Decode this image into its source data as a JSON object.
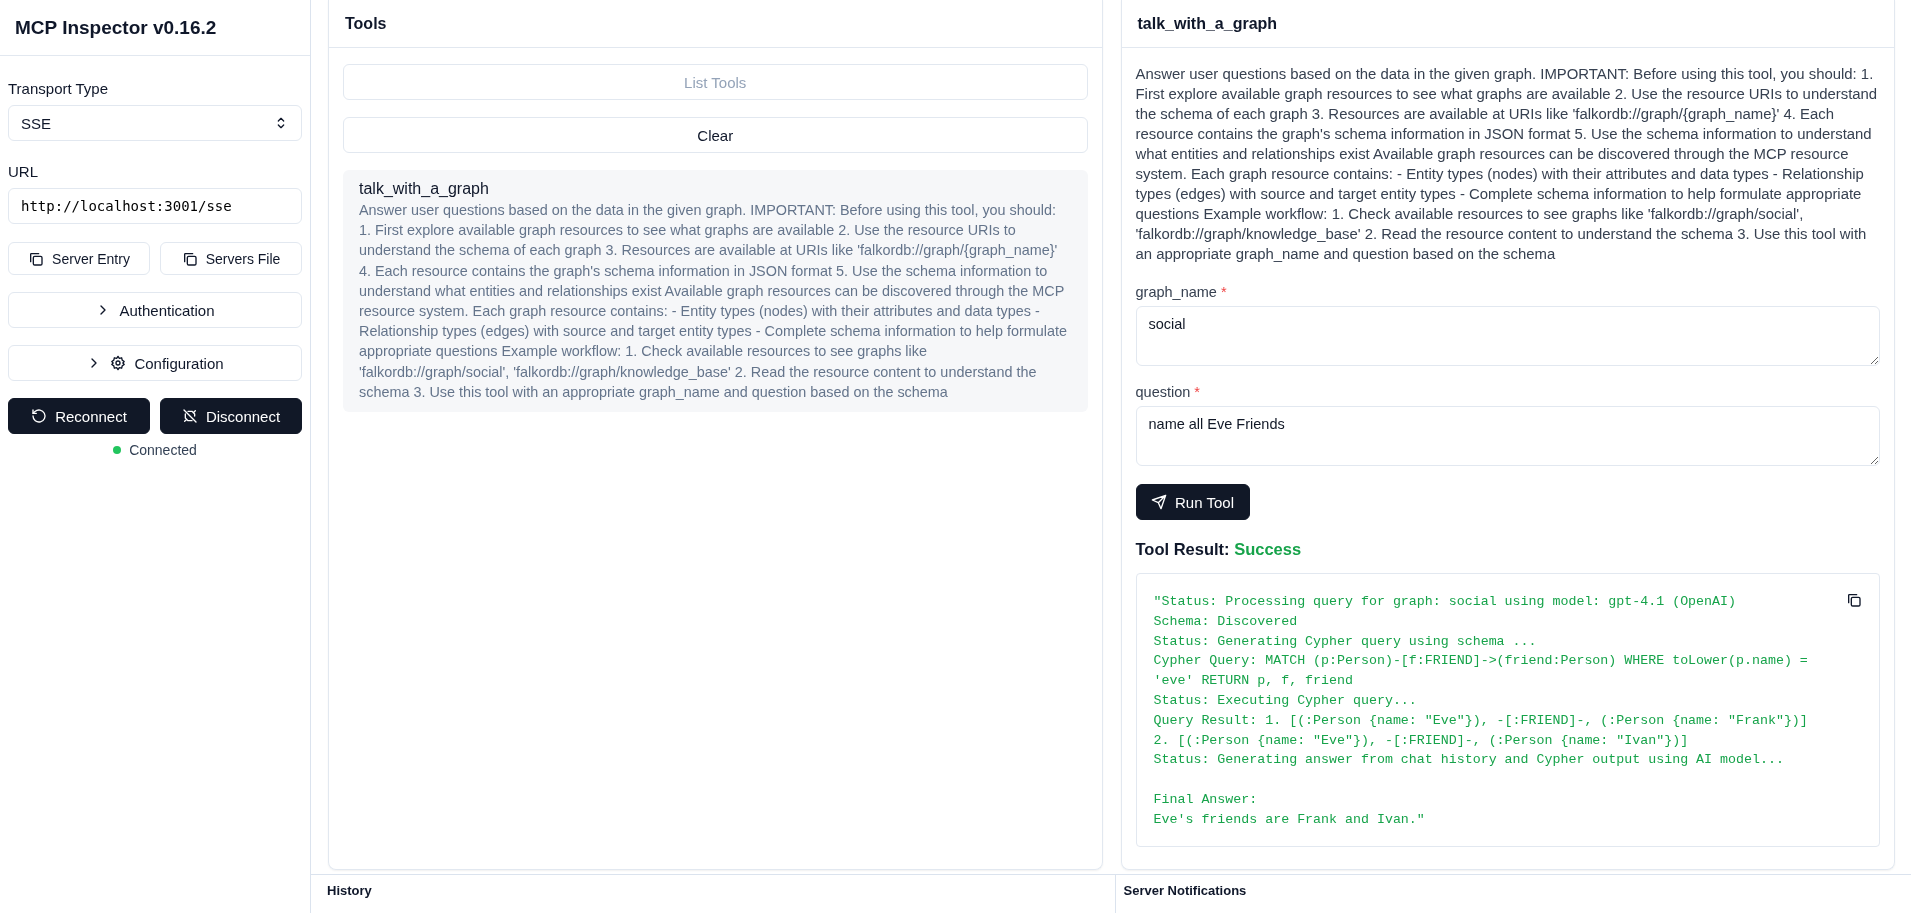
{
  "app": {
    "title": "MCP Inspector v0.16.2"
  },
  "sidebar": {
    "transport": {
      "label": "Transport Type",
      "value": "SSE"
    },
    "url": {
      "label": "URL",
      "value": "http://localhost:3001/sse"
    },
    "copy_buttons": [
      "Server Entry",
      "Servers File"
    ],
    "sections": [
      {
        "label": "Authentication",
        "kind": "plain",
        "expanded": false
      },
      {
        "label": "Configuration",
        "kind": "gear",
        "expanded": false
      }
    ],
    "actions": [
      {
        "label": "Reconnect",
        "kind": "reconnect"
      },
      {
        "label": "Disconnect",
        "kind": "disconnect"
      }
    ],
    "status": {
      "text": "Connected",
      "connected": true
    }
  },
  "tools_panel": {
    "title": "Tools",
    "list_button": {
      "label": "List Tools",
      "disabled": true
    },
    "clear_button": "Clear",
    "items": [
      {
        "name": "talk_with_a_graph",
        "description": "Answer user questions based on the data in the given graph. IMPORTANT: Before using this tool, you should: 1. First explore available graph resources to see what graphs are available 2. Use the resource URIs to understand the schema of each graph 3. Resources are available at URIs like 'falkordb://graph/{graph_name}' 4. Each resource contains the graph's schema information in JSON format 5. Use the schema information to understand what entities and relationships exist Available graph resources can be discovered through the MCP resource system. Each graph resource contains: - Entity types (nodes) with their attributes and data types - Relationship types (edges) with source and target entity types - Complete schema information to help formulate appropriate questions Example workflow: 1. Check available resources to see graphs like 'falkordb://graph/social', 'falkordb://graph/knowledge_base' 2. Read the resource content to understand the schema 3. Use this tool with an appropriate graph_name and question based on the schema"
      }
    ]
  },
  "tool_detail": {
    "title": "talk_with_a_graph",
    "description": "Answer user questions based on the data in the given graph. IMPORTANT: Before using this tool, you should: 1. First explore available graph resources to see what graphs are available 2. Use the resource URIs to understand the schema of each graph 3. Resources are available at URIs like 'falkordb://graph/{graph_name}' 4. Each resource contains the graph's schema information in JSON format 5. Use the schema information to understand what entities and relationships exist Available graph resources can be discovered through the MCP resource system. Each graph resource contains: - Entity types (nodes) with their attributes and data types - Relationship types (edges) with source and target entity types - Complete schema information to help formulate appropriate questions Example workflow: 1. Check available resources to see graphs like 'falkordb://graph/social', 'falkordb://graph/knowledge_base' 2. Read the resource content to understand the schema 3. Use this tool with an appropriate graph_name and question based on the schema",
    "params": [
      {
        "name": "graph_name",
        "required_mark": "*",
        "value": "social"
      },
      {
        "name": "question",
        "required_mark": "*",
        "value": "name all Eve Friends"
      }
    ],
    "run_button": "Run Tool",
    "result": {
      "label": "Tool Result:",
      "status": "Success",
      "ok": true,
      "text": "\"Status: Processing query for graph: social using model: gpt-4.1 (OpenAI)\nSchema: Discovered\nStatus: Generating Cypher query using schema ...\nCypher Query: MATCH (p:Person)-[f:FRIEND]->(friend:Person) WHERE toLower(p.name) =\n'eve' RETURN p, f, friend\nStatus: Executing Cypher query...\nQuery Result: 1. [(:Person {name: \"Eve\"}), -[:FRIEND]-, (:Person {name: \"Frank\"})]\n2. [(:Person {name: \"Eve\"}), -[:FRIEND]-, (:Person {name: \"Ivan\"})]\nStatus: Generating answer from chat history and Cypher output using AI model...\n\nFinal Answer:\nEve's friends are Frank and Ivan.\""
    }
  },
  "bottom_panels": [
    {
      "title": "History"
    },
    {
      "title": "Server Notifications"
    }
  ]
}
